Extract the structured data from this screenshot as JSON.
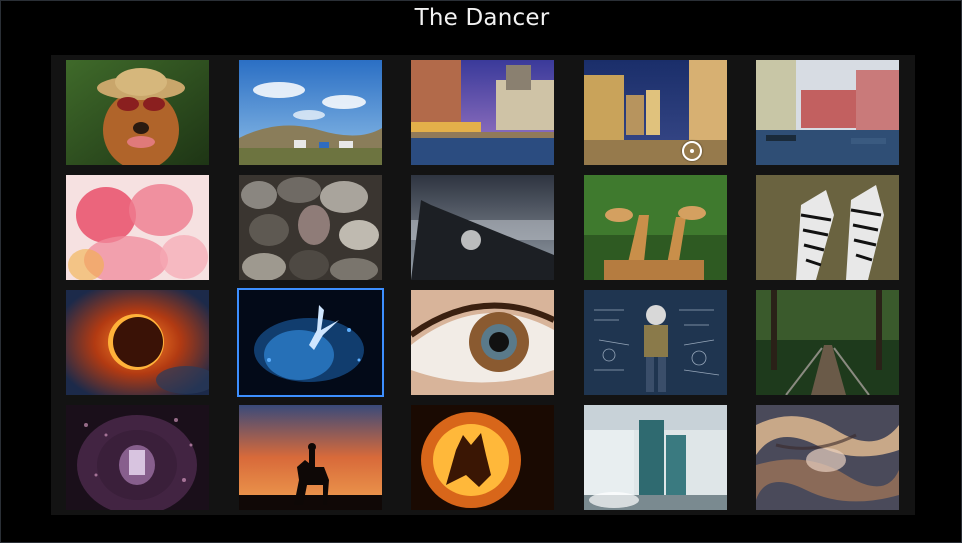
{
  "window": {
    "title": "The Dancer"
  },
  "gallery": {
    "selected_index": 11,
    "photos": [
      {
        "subject": "dog-with-hat-sunglasses"
      },
      {
        "subject": "sky-hills-tents"
      },
      {
        "subject": "canal-town-dusk"
      },
      {
        "subject": "street-night"
      },
      {
        "subject": "venice-canal"
      },
      {
        "subject": "pink-petals"
      },
      {
        "subject": "pebbles"
      },
      {
        "subject": "airplane-wing"
      },
      {
        "subject": "giraffes"
      },
      {
        "subject": "zebras"
      },
      {
        "subject": "solar-eclipse"
      },
      {
        "subject": "the-dancer"
      },
      {
        "subject": "eye-closeup"
      },
      {
        "subject": "chalkboard-man"
      },
      {
        "subject": "forest-bridge"
      },
      {
        "subject": "flower-tunnel"
      },
      {
        "subject": "horse-rider-sunset"
      },
      {
        "subject": "pumpkin-wolf"
      },
      {
        "subject": "waterfall-building"
      },
      {
        "subject": "jupiter-clouds"
      }
    ]
  },
  "colors": {
    "selection": "#3d8fff",
    "panel": "#131313",
    "background": "#000000"
  }
}
